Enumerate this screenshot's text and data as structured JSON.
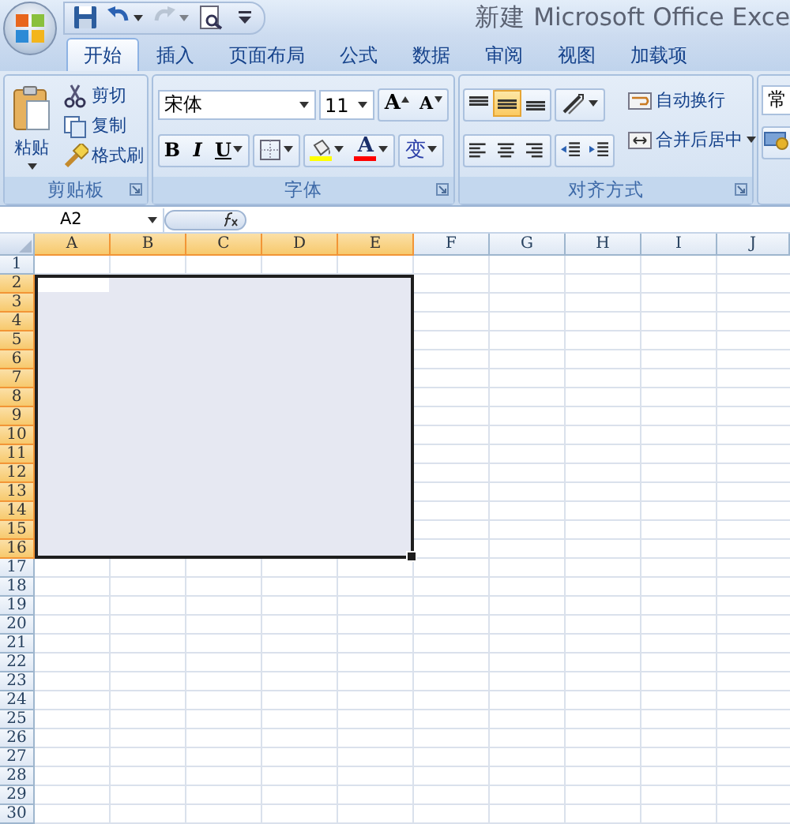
{
  "window": {
    "title": "新建 Microsoft Office Exce"
  },
  "quick_access": [
    {
      "kind": "save",
      "disabled": false
    },
    {
      "kind": "undo",
      "disabled": false
    },
    {
      "kind": "redo",
      "disabled": true
    },
    {
      "kind": "preview",
      "disabled": false
    },
    {
      "kind": "customize",
      "disabled": false
    }
  ],
  "tabs": [
    {
      "label": "开始",
      "selected": true
    },
    {
      "label": "插入",
      "selected": false
    },
    {
      "label": "页面布局",
      "selected": false
    },
    {
      "label": "公式",
      "selected": false
    },
    {
      "label": "数据",
      "selected": false
    },
    {
      "label": "审阅",
      "selected": false
    },
    {
      "label": "视图",
      "selected": false
    },
    {
      "label": "加载项",
      "selected": false
    }
  ],
  "clipboard": {
    "label": "剪贴板",
    "paste": "粘贴",
    "items": [
      {
        "kind": "cut",
        "label": "剪切"
      },
      {
        "kind": "copy",
        "label": "复制"
      },
      {
        "kind": "format_painter",
        "label": "格式刷"
      }
    ]
  },
  "font": {
    "label": "字体",
    "font_name": "宋体",
    "font_size": "11",
    "grow": "A",
    "shrink": "A",
    "styles": [
      {
        "kind": "bold",
        "label": "B"
      },
      {
        "kind": "italic",
        "label": "I"
      },
      {
        "kind": "underline",
        "label": "U"
      }
    ],
    "color_buttons": [
      {
        "kind": "fill",
        "color": "#ffff00"
      },
      {
        "kind": "font",
        "label": "A",
        "color": "#ff0000"
      }
    ],
    "phonetic": "变"
  },
  "alignment": {
    "label": "对齐方式",
    "vertical": [
      {
        "kind": "top",
        "selected": false
      },
      {
        "kind": "middle",
        "selected": true
      },
      {
        "kind": "bottom",
        "selected": false
      }
    ],
    "horizontal": [
      {
        "kind": "left",
        "selected": false
      },
      {
        "kind": "center",
        "selected": false
      },
      {
        "kind": "right",
        "selected": false
      }
    ],
    "wrap": "自动换行",
    "merge": "合并后居中"
  },
  "number": {
    "format": "常"
  },
  "formula_bar": {
    "name_box": "A2"
  },
  "sheet": {
    "columns": [
      {
        "label": "A",
        "selected": true
      },
      {
        "label": "B",
        "selected": true
      },
      {
        "label": "C",
        "selected": true
      },
      {
        "label": "D",
        "selected": true
      },
      {
        "label": "E",
        "selected": true
      },
      {
        "label": "F",
        "selected": false
      },
      {
        "label": "G",
        "selected": false
      },
      {
        "label": "H",
        "selected": false
      },
      {
        "label": "I",
        "selected": false
      },
      {
        "label": "J",
        "selected": false
      }
    ],
    "rows": [
      {
        "label": "1",
        "selected": false
      },
      {
        "label": "2",
        "selected": true
      },
      {
        "label": "3",
        "selected": true
      },
      {
        "label": "4",
        "selected": true
      },
      {
        "label": "5",
        "selected": true
      },
      {
        "label": "6",
        "selected": true
      },
      {
        "label": "7",
        "selected": true
      },
      {
        "label": "8",
        "selected": true
      },
      {
        "label": "9",
        "selected": true
      },
      {
        "label": "10",
        "selected": true
      },
      {
        "label": "11",
        "selected": true
      },
      {
        "label": "12",
        "selected": true
      },
      {
        "label": "13",
        "selected": true
      },
      {
        "label": "14",
        "selected": true
      },
      {
        "label": "15",
        "selected": true
      },
      {
        "label": "16",
        "selected": true
      },
      {
        "label": "17",
        "selected": false
      },
      {
        "label": "18",
        "selected": false
      },
      {
        "label": "19",
        "selected": false
      },
      {
        "label": "20",
        "selected": false
      },
      {
        "label": "21",
        "selected": false
      },
      {
        "label": "22",
        "selected": false
      },
      {
        "label": "23",
        "selected": false
      },
      {
        "label": "24",
        "selected": false
      },
      {
        "label": "25",
        "selected": false
      },
      {
        "label": "26",
        "selected": false
      },
      {
        "label": "27",
        "selected": false
      },
      {
        "label": "28",
        "selected": false
      },
      {
        "label": "29",
        "selected": false
      },
      {
        "label": "30",
        "selected": false
      }
    ]
  }
}
